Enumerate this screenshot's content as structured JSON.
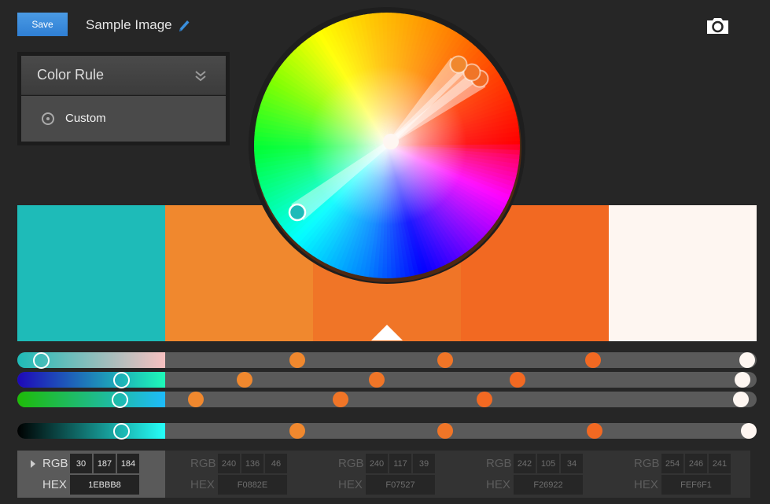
{
  "header": {
    "save_label": "Save",
    "title": "Sample Image",
    "edit_icon": "pencil-icon",
    "camera_icon": "camera-icon"
  },
  "color_rule": {
    "label": "Color Rule",
    "toggle_icon": "double-chevron-down-icon",
    "selected_option": "Custom"
  },
  "palette": {
    "selected_index": 0,
    "swatches": [
      {
        "hex": "1EBBB8",
        "rgb": [
          30,
          187,
          184
        ],
        "color": "#1ebbb8"
      },
      {
        "hex": "F0882E",
        "rgb": [
          240,
          136,
          46
        ],
        "color": "#f0882e"
      },
      {
        "hex": "F07527",
        "rgb": [
          240,
          117,
          39
        ],
        "color": "#f07527"
      },
      {
        "hex": "F26922",
        "rgb": [
          242,
          105,
          34
        ],
        "color": "#f26922"
      },
      {
        "hex": "FEF6F1",
        "rgb": [
          254,
          246,
          241
        ],
        "color": "#fef6f1"
      }
    ]
  },
  "sliders": [
    {
      "name": "red",
      "gradient": [
        "#1ebbb8",
        "#f7c0c0"
      ],
      "values": [
        0.032,
        0.379,
        0.579,
        0.779,
        0.987
      ]
    },
    {
      "name": "green",
      "gradient": [
        "#1e08b8",
        "#1efab8"
      ],
      "values": [
        0.141,
        0.307,
        0.486,
        0.677,
        0.981
      ]
    },
    {
      "name": "blue",
      "gradient": [
        "#1ebb08",
        "#1ebbfa"
      ],
      "values": [
        0.139,
        0.242,
        0.437,
        0.632,
        0.979
      ]
    },
    {
      "name": "brightness",
      "gradient": [
        "#000000",
        "#26fff9"
      ],
      "values": [
        0.141,
        0.379,
        0.579,
        0.781,
        0.989
      ]
    }
  ],
  "labels": {
    "rgb": "RGB",
    "hex": "HEX"
  }
}
